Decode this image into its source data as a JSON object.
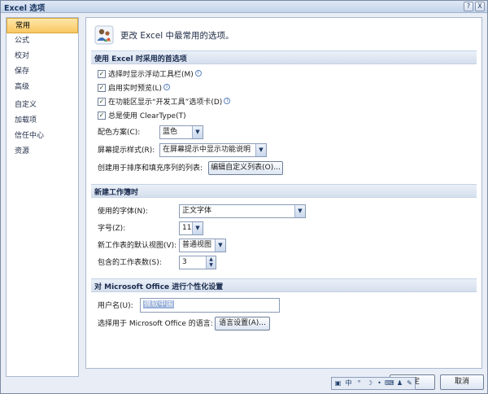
{
  "window": {
    "title": "Excel 选项",
    "help_glyph": "?",
    "close_glyph": "X"
  },
  "sidebar": {
    "items": [
      {
        "label": "常用",
        "selected": true
      },
      {
        "label": "公式"
      },
      {
        "label": "校对"
      },
      {
        "label": "保存"
      },
      {
        "label": "高级"
      },
      {
        "label": "自定义"
      },
      {
        "label": "加载项"
      },
      {
        "label": "信任中心"
      },
      {
        "label": "资源"
      }
    ]
  },
  "header": {
    "text": "更改 Excel 中最常用的选项。"
  },
  "sections": {
    "top": {
      "title": "使用 Excel 时采用的首选项",
      "options": [
        {
          "label": "选择时显示浮动工具栏(M)",
          "checked": true,
          "info": true
        },
        {
          "label": "启用实时预览(L)",
          "checked": true,
          "info": true
        },
        {
          "label": "在功能区显示“开发工具”选项卡(D)",
          "checked": true,
          "info": true
        },
        {
          "label": "总是使用 ClearType(T)",
          "checked": true,
          "info": false
        }
      ],
      "color_scheme_label": "配色方案(C):",
      "color_scheme_value": "蓝色",
      "screentip_label": "屏幕提示样式(R):",
      "screentip_value": "在屏幕提示中显示功能说明",
      "custom_list_label": "创建用于排序和填充序列的列表:",
      "custom_list_button": "编辑自定义列表(O)..."
    },
    "workbook": {
      "title": "新建工作簿时",
      "font_label": "使用的字体(N):",
      "font_value": "正文字体",
      "size_label": "字号(Z):",
      "size_value": "11",
      "view_label": "新工作表的默认视图(V):",
      "view_value": "普通视图",
      "sheets_label": "包含的工作表数(S):",
      "sheets_value": "3"
    },
    "personalize": {
      "title": "对 Microsoft Office 进行个性化设置",
      "username_label": "用户名(U):",
      "username_value": "微软中国",
      "language_label": "选择用于 Microsoft Office 的语言:",
      "language_button": "语言设置(A)..."
    }
  },
  "footer": {
    "ok_label": "确定",
    "cancel_label": "取消"
  },
  "langbar": {
    "items": [
      {
        "name": "ime-logo-icon",
        "glyph": "▣"
      },
      {
        "name": "chinese-mode-icon",
        "glyph": "中"
      },
      {
        "name": "punctuation-icon",
        "glyph": "°"
      },
      {
        "name": "moon-icon",
        "glyph": "☽"
      },
      {
        "name": "dot-icon",
        "glyph": "•"
      },
      {
        "name": "keyboard-icon",
        "glyph": "⌨"
      },
      {
        "name": "user-icon",
        "glyph": "♟"
      },
      {
        "name": "wrench-icon",
        "glyph": "✎"
      }
    ]
  },
  "colors": {
    "selected_bg": "#f9c762",
    "section_bar": "#d5dfed",
    "window_bg": "#e9eef6"
  }
}
